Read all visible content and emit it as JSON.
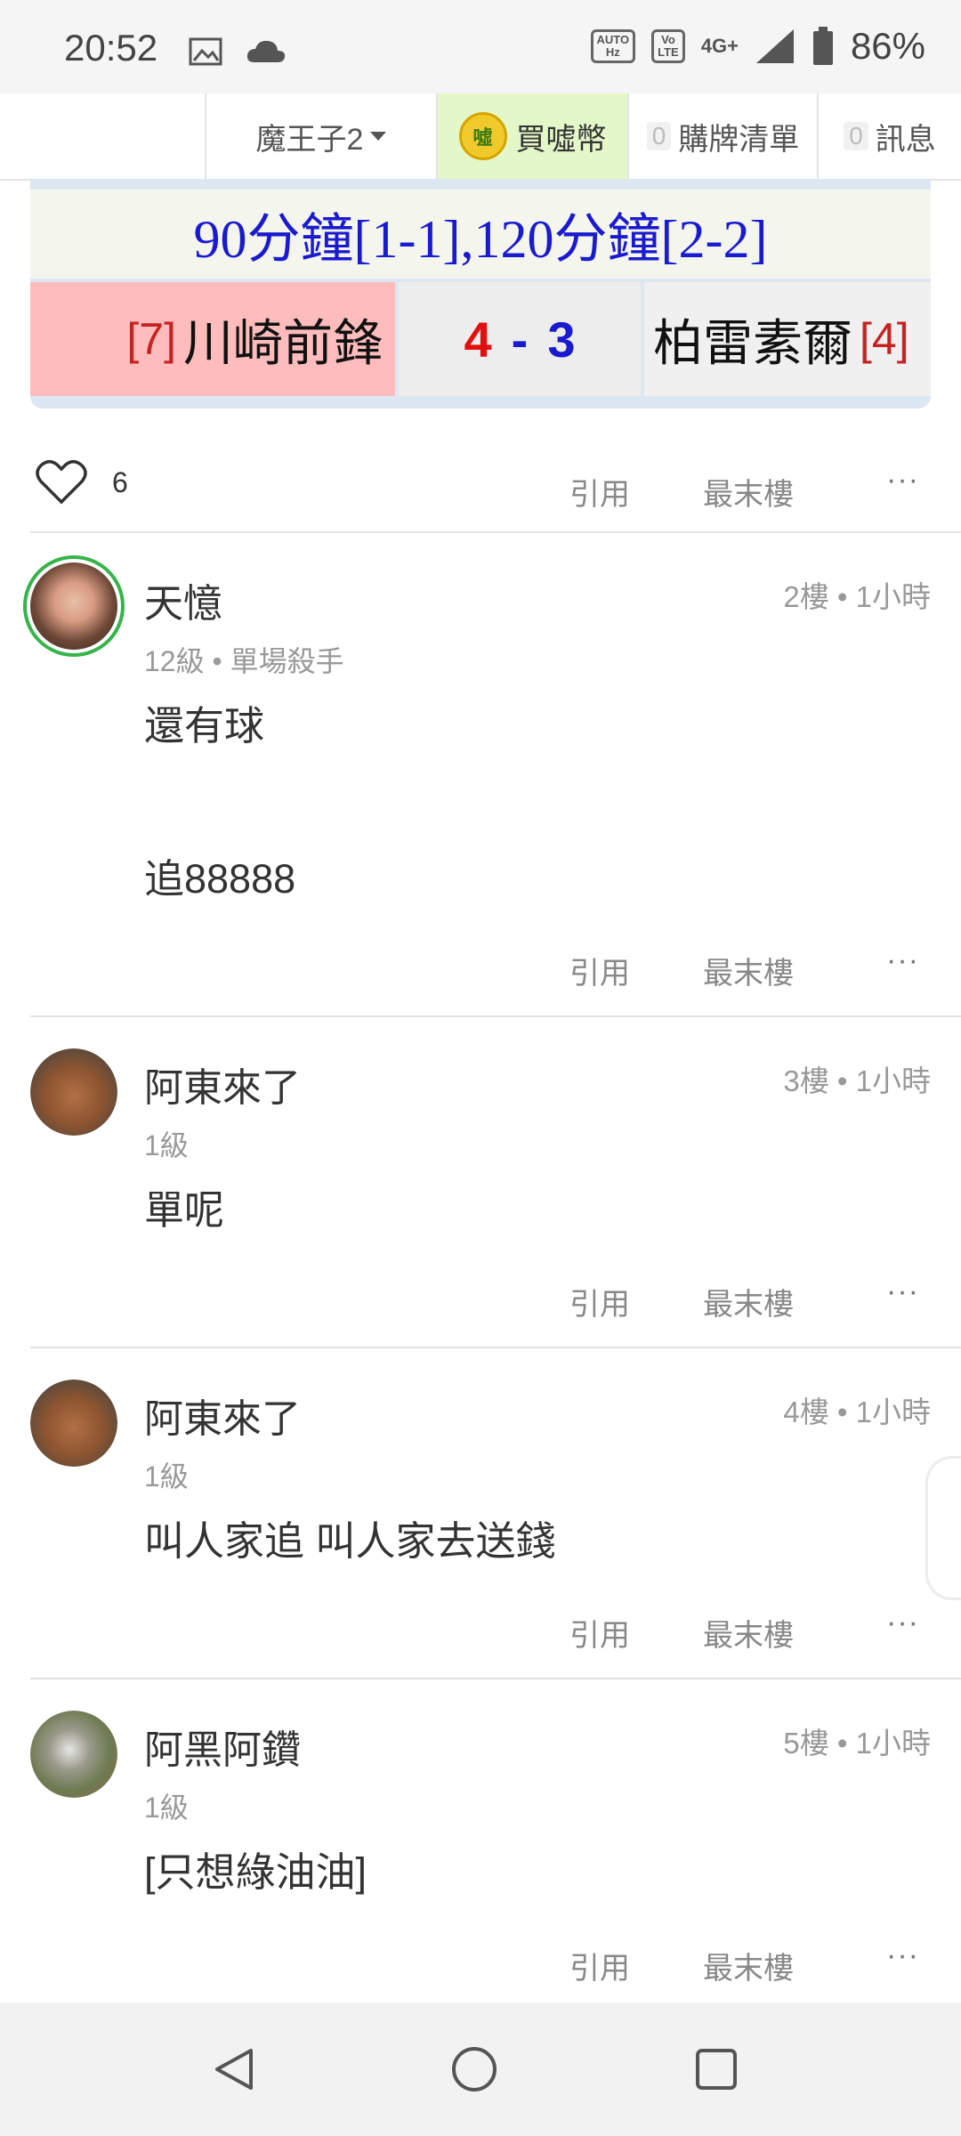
{
  "status_bar": {
    "time": "20:52",
    "battery": "86%",
    "icons": [
      "image-icon",
      "cloud-icon",
      "auto-hz-icon",
      "volte-icon",
      "4g-icon",
      "signal-icon",
      "battery-icon"
    ],
    "auto_label": "AUTO",
    "hz_label": "Hz",
    "vo_label": "Vo",
    "lte_label": "LTE",
    "net_label": "4G+"
  },
  "nav": {
    "username": "魔王子2",
    "coin_label": "買噓幣",
    "coin_badge": "噓",
    "cart_count": "0",
    "cart_label": "購牌清單",
    "msg_count": "0",
    "msg_label": "訊息"
  },
  "score_card": {
    "extra_time": "90分鐘[1-1],120分鐘[2-2]",
    "home_rank": "[7]",
    "home_team": "川崎前鋒",
    "home_score": "4",
    "dash": "-",
    "away_score": "3",
    "away_team": "柏雷素爾",
    "away_rank": "[4]"
  },
  "post_actions": {
    "likes": "6",
    "quote": "引用",
    "last_floor": "最末樓",
    "more": "···"
  },
  "comments": [
    {
      "name": "天憶",
      "meta": "2樓 • 1小時",
      "level": "12級 • 單場殺手",
      "body_line1": "還有球",
      "body_line2": "追88888"
    },
    {
      "name": "阿東來了",
      "meta": "3樓 • 1小時",
      "level": "1級",
      "body_line1": "單呢"
    },
    {
      "name": "阿東來了",
      "meta": "4樓 • 1小時",
      "level": "1級",
      "body_line1": "叫人家追 叫人家去送錢"
    },
    {
      "name": "阿黑阿鑽",
      "meta": "5樓 • 1小時",
      "level": "1級",
      "body_line1": "[只想綠油油]"
    }
  ],
  "comment_actions": {
    "quote": "引用",
    "last_floor": "最末樓",
    "more": "···"
  },
  "colors": {
    "accent_blue": "#1a1ad0",
    "score_red": "#e01010",
    "home_bg": "#ffbcbc",
    "coin_bg": "#e4f7c9",
    "avatar_ring": "#36b34a"
  }
}
